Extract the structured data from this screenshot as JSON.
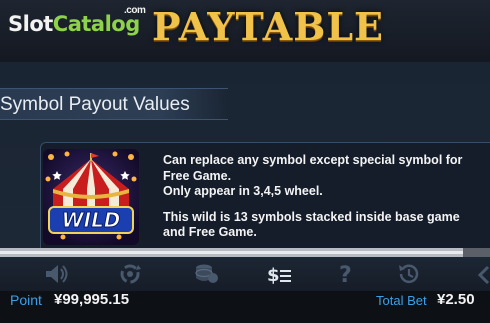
{
  "header": {
    "logo": {
      "slot": "Slot",
      "catalog": "Catalog",
      "com": ".com"
    },
    "title": "PAYTABLE"
  },
  "section": {
    "title": "Symbol Payout Values"
  },
  "wild_symbol": {
    "icon_label": "WILD",
    "description_1": "Can replace any symbol except special symbol for Free Game.",
    "description_2": "Only appear in 3,4,5 wheel.",
    "description_3": "This wild is 13 symbols stacked inside base game and Free Game."
  },
  "toolbar": {
    "icons": [
      "sound-icon",
      "autoplay-icon",
      "chips-icon",
      "paytable-icon",
      "help-icon",
      "history-icon",
      "back-arrow-icon"
    ],
    "active": "paytable-icon"
  },
  "status": {
    "point_label": "Point",
    "point_value": "¥99,995.15",
    "total_bet_label": "Total Bet",
    "total_bet_value": "¥2.50"
  },
  "colors": {
    "title_gold": "#f0c24a",
    "accent_blue": "#3aa1e8",
    "logo_green": "#8ed24a"
  }
}
